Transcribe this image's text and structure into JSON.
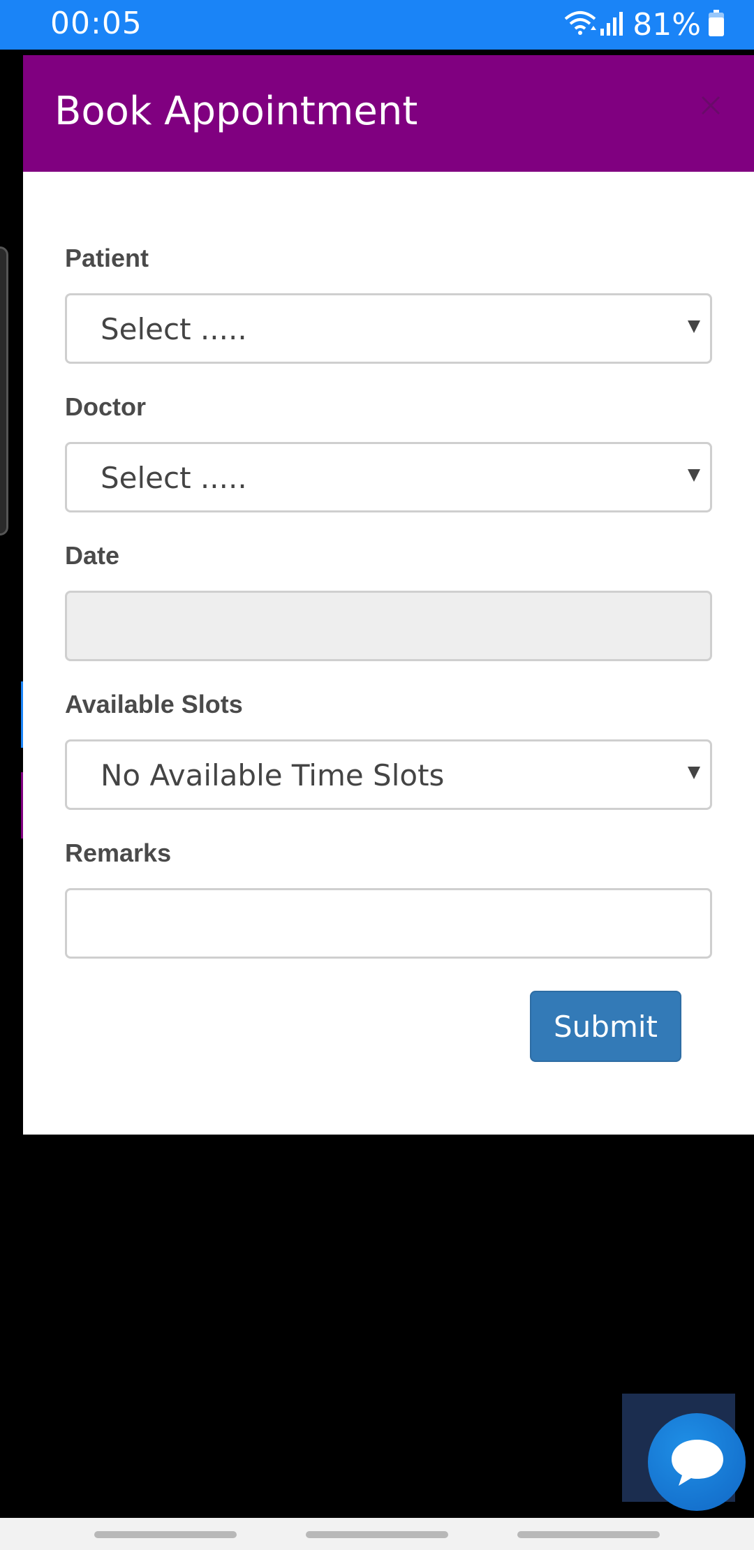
{
  "status_bar": {
    "time": "00:05",
    "battery": "81%",
    "icons": [
      "wifi-icon",
      "signal-icon",
      "battery-icon"
    ]
  },
  "modal": {
    "title": "Book Appointment",
    "close_icon": "close-icon",
    "header_color": "#800080"
  },
  "form": {
    "patient": {
      "label": "Patient",
      "selected": "Select ....."
    },
    "doctor": {
      "label": "Doctor",
      "selected": "Select ....."
    },
    "date": {
      "label": "Date",
      "value": ""
    },
    "slots": {
      "label": "Available Slots",
      "selected": "No Available Time Slots"
    },
    "remarks": {
      "label": "Remarks",
      "value": ""
    },
    "submit_label": "Submit",
    "submit_color": "#337ab7"
  },
  "chat": {
    "icon": "chat-bubble-icon"
  },
  "colors": {
    "status_bar": "#1a84f7"
  }
}
